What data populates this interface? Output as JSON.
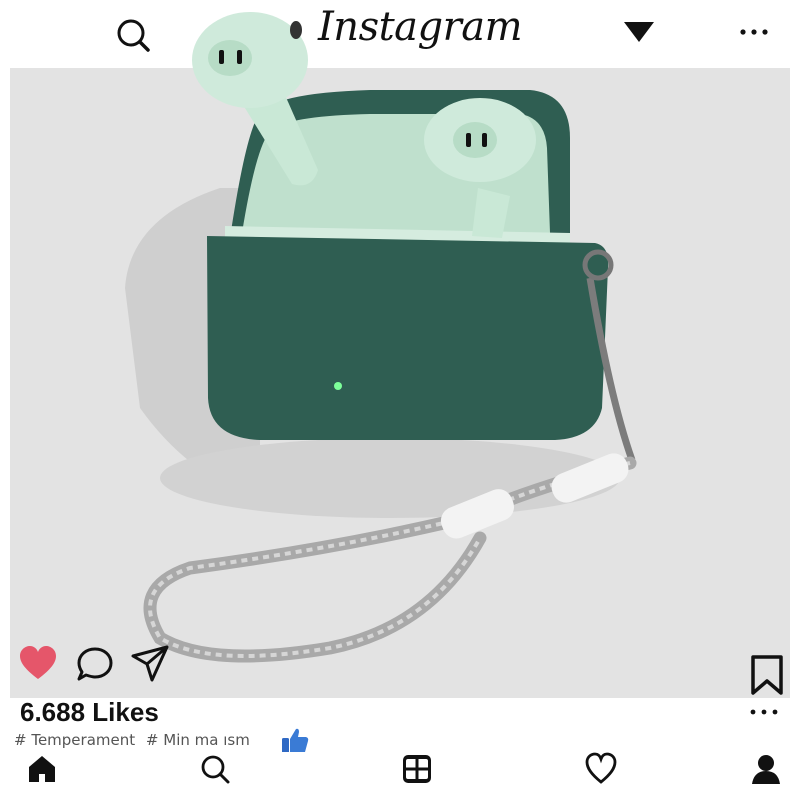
{
  "header": {
    "logo_text": "Instagram",
    "icons": [
      "search-icon",
      "dropdown-triangle-icon",
      "more-horizontal-icon"
    ]
  },
  "post": {
    "image_alt": "Mint green earbuds in an open dark green case with a braided lanyard",
    "liked": true,
    "like_color": "#e5566a",
    "likes_text": "6.688 Likes",
    "hashtags": [
      "# Temperament",
      "# Min ma ısm"
    ],
    "actions": [
      "heart-icon",
      "comment-icon",
      "send-icon",
      "bookmark-icon"
    ]
  },
  "bottom_nav": {
    "items": [
      "home-icon",
      "search-icon",
      "add-post-icon",
      "activity-heart-icon",
      "profile-icon"
    ]
  },
  "colors": {
    "case_dark_green": "#2f5e52",
    "earbud_mint": "#c9e8d6",
    "thumb_blue": "#3a7bd5"
  }
}
